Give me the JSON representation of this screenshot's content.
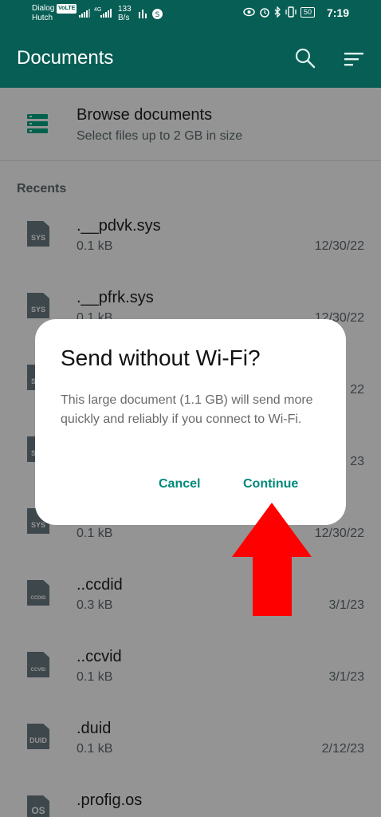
{
  "status_bar": {
    "carrier_line1": "Dialog",
    "carrier_tag": "VoLTE",
    "carrier_line2": "Hutch",
    "network_type": "4G",
    "speed_value": "133",
    "speed_unit": "B/s",
    "battery": "50",
    "time": "7:19"
  },
  "app_bar": {
    "title": "Documents",
    "search_icon": "search-icon",
    "sort_icon": "sort-icon"
  },
  "browse": {
    "title": "Browse documents",
    "subtitle": "Select files up to 2 GB in size",
    "icon": "stack-icon"
  },
  "recents": {
    "heading": "Recents",
    "items": [
      {
        "icon_label": "SYS",
        "name": ".__pdvk.sys",
        "size": "0.1 kB",
        "date": "12/30/22"
      },
      {
        "icon_label": "SYS",
        "name": ".__pfrk.sys",
        "size": "0.1 kB",
        "date": "12/30/22"
      },
      {
        "icon_label": "SYS",
        "name": "",
        "size": "",
        "date": "22"
      },
      {
        "icon_label": "SYS",
        "name": "",
        "size": "",
        "date": "23"
      },
      {
        "icon_label": "SYS",
        "name": "",
        "size": "0.1 kB",
        "date": "12/30/22"
      },
      {
        "icon_label": "CCDID",
        "name": "..ccdid",
        "size": "0.3 kB",
        "date": "3/1/23"
      },
      {
        "icon_label": "CCVID",
        "name": "..ccvid",
        "size": "0.1 kB",
        "date": "3/1/23"
      },
      {
        "icon_label": "DUID",
        "name": ".duid",
        "size": "0.1 kB",
        "date": "2/12/23"
      },
      {
        "icon_label": "OS",
        "name": ".profig.os",
        "size": "",
        "date": ""
      }
    ]
  },
  "dialog": {
    "title": "Send without Wi-Fi?",
    "body": "This large document (1.1 GB) will send more quickly and reliably if you connect to Wi-Fi.",
    "cancel_label": "Cancel",
    "continue_label": "Continue"
  },
  "colors": {
    "app_bar": "#075e54",
    "accent": "#00897b",
    "annotation_arrow": "#ff0000"
  }
}
